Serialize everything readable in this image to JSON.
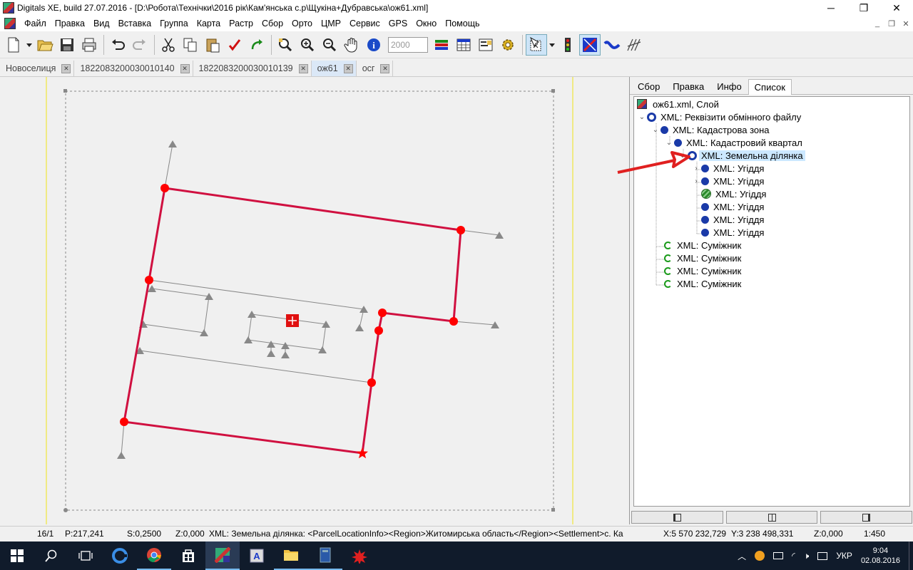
{
  "window": {
    "title": "Digitals XE, build 27.07.2016 - [D:\\Робота\\Технічки\\2016 рік\\Кам'янська с.р\\Щукіна+Дубравська\\ож61.xml]",
    "min": "─",
    "restore": "❐",
    "close": "✕"
  },
  "menu": [
    "Файл",
    "Правка",
    "Вид",
    "Вставка",
    "Группа",
    "Карта",
    "Растр",
    "Сбор",
    "Орто",
    "ЦМР",
    "Сервис",
    "GPS",
    "Окно",
    "Помощь"
  ],
  "mdi_controls": [
    "_",
    "❐",
    "✕"
  ],
  "toolbar": {
    "scale_value": "2000"
  },
  "doc_tabs": [
    {
      "label": "Новоселиця",
      "active": false
    },
    {
      "label": "1822083200030010140",
      "active": false
    },
    {
      "label": "1822083200030010139",
      "active": false
    },
    {
      "label": "ож61",
      "active": true
    },
    {
      "label": "осг",
      "active": false
    }
  ],
  "tab_close": "✕",
  "right_tabs": [
    {
      "label": "Сбор",
      "active": false
    },
    {
      "label": "Правка",
      "active": false
    },
    {
      "label": "Инфо",
      "active": false
    },
    {
      "label": "Список",
      "active": true
    }
  ],
  "tree": {
    "root": "ож61.xml, Слой",
    "exchange": "XML: Реквізити обмінного файлу",
    "zone": "XML: Кадастрова зона",
    "quarter": "XML: Кадастровий квартал",
    "parcel": "XML: Земельна ділянка",
    "lands": [
      "XML: Угіддя",
      "XML: Угіддя",
      "XML: Угіддя",
      "XML: Угіддя",
      "XML: Угіддя",
      "XML: Угіддя"
    ],
    "neighbors": [
      "XML: Суміжник",
      "XML: Суміжник",
      "XML: Суміжник",
      "XML: Суміжник"
    ]
  },
  "status": {
    "page": "16/1",
    "p": "P:217,241",
    "s": "S:0,2500",
    "z1": "Z:0,000",
    "info": "XML: Земельна ділянка: <ParcelLocationInfo><Region>Житомирська область</Region><Settlement>с. Ка",
    "x": "X:5 570 232,729",
    "y": "Y:3 238 498,331",
    "z2": "Z:0,000",
    "scale": "1:450"
  },
  "tray": {
    "lang": "УКР",
    "time": "9:04",
    "date": "02.08.2016"
  },
  "colors": {
    "parcel_line": "#d01040",
    "vertex": "#ff0000",
    "annotation_arrow": "#e02020",
    "guide_line": "#f5f07a"
  }
}
